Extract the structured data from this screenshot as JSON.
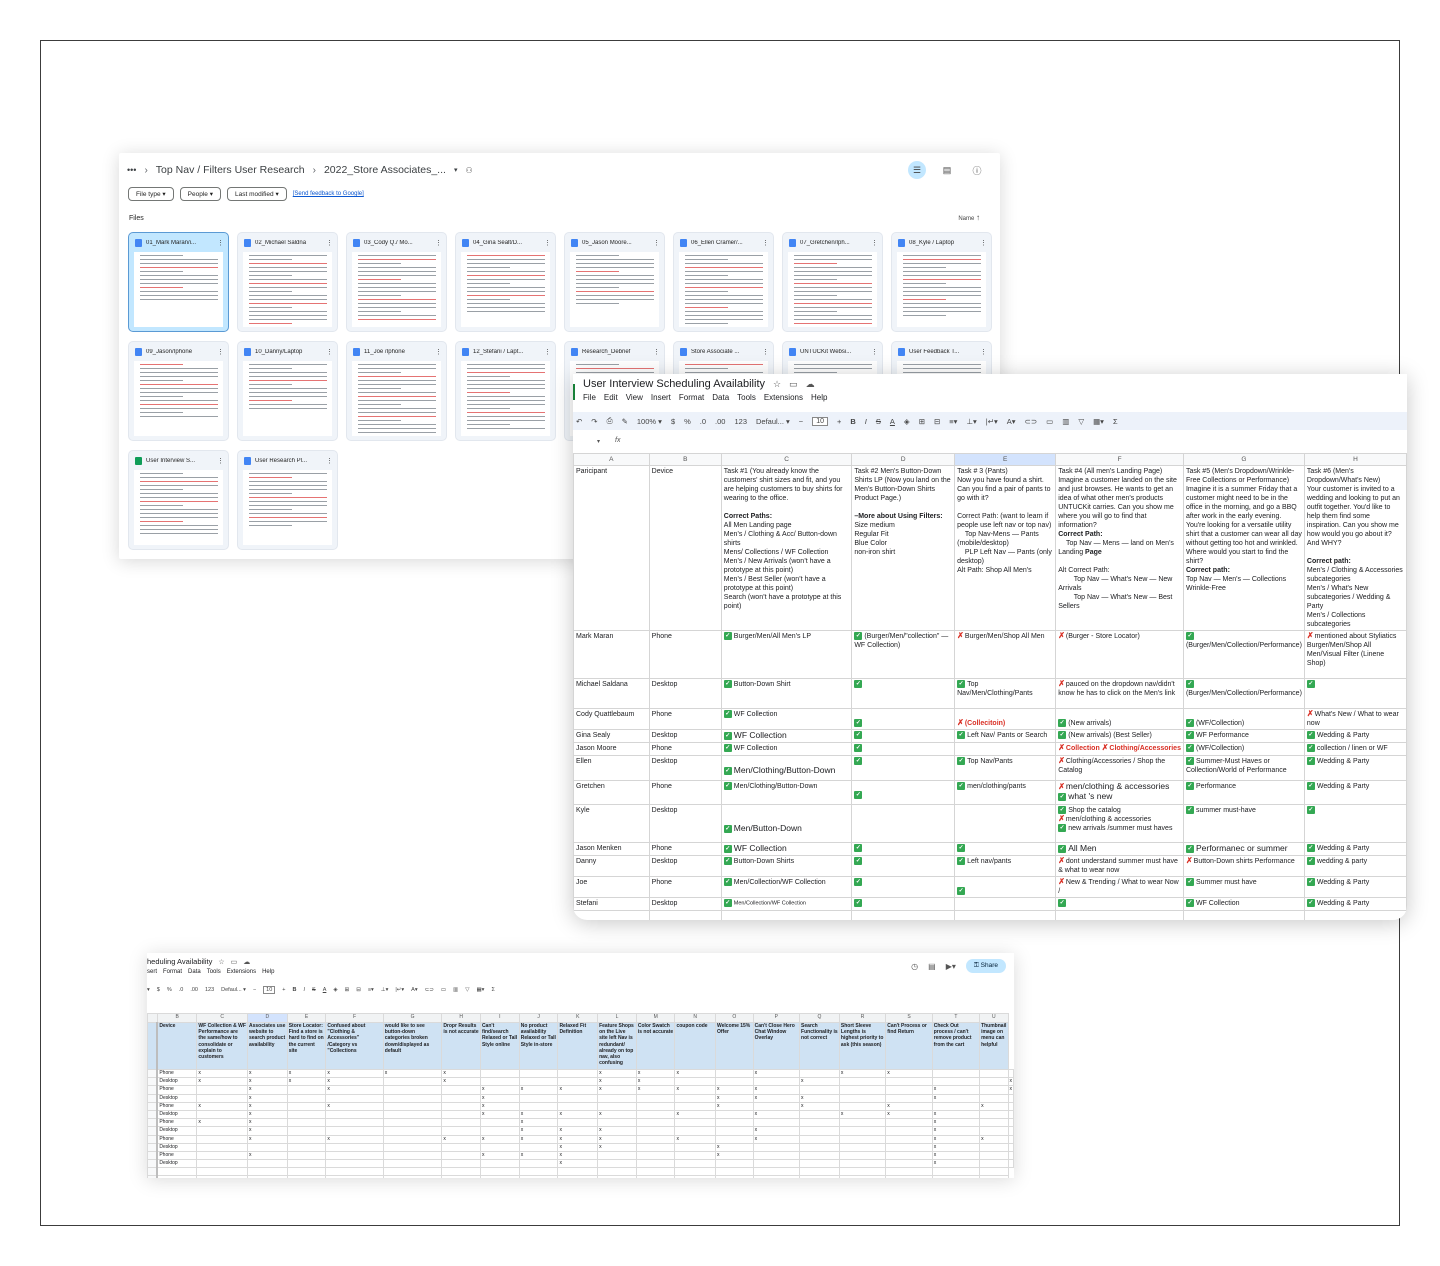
{
  "drive": {
    "breadcrumb": [
      "Top Nav / Filters User Research",
      "2022_Store Associates_..."
    ],
    "filters": [
      "File type",
      "People",
      "Last modified"
    ],
    "feedback_link": "[Send feedback to Google]",
    "files_label": "Files",
    "sort_label": "Name",
    "files": [
      {
        "name": "01_Mark Maran/i...",
        "type": "doc"
      },
      {
        "name": "02_Michael Saldna",
        "type": "doc"
      },
      {
        "name": "03_Cody Q./ Mo...",
        "type": "doc"
      },
      {
        "name": "04_Gina Sealt/D...",
        "type": "doc"
      },
      {
        "name": "05_Jason Moore...",
        "type": "doc"
      },
      {
        "name": "06_Ellen Cramer/...",
        "type": "doc"
      },
      {
        "name": "07_Gretchen/Iph...",
        "type": "doc"
      },
      {
        "name": "08_Kyle / Laptop",
        "type": "doc"
      },
      {
        "name": "09_Jason/Iphone",
        "type": "doc"
      },
      {
        "name": "10_Danny/Laptop",
        "type": "doc"
      },
      {
        "name": "11_Joe /Iphone",
        "type": "doc"
      },
      {
        "name": "12_Stefani / Lapt...",
        "type": "doc"
      },
      {
        "name": "Research_Debrief",
        "type": "doc"
      },
      {
        "name": "Store Associate ...",
        "type": "doc"
      },
      {
        "name": "UNTUCKit Websi...",
        "type": "slides"
      },
      {
        "name": "User Feedback T...",
        "type": "doc"
      },
      {
        "name": "User Interview S...",
        "type": "sheet"
      },
      {
        "name": "User Research Pl...",
        "type": "doc"
      }
    ]
  },
  "sheet": {
    "title": "User Interview Scheduling Availability",
    "menu": [
      "File",
      "Edit",
      "View",
      "Insert",
      "Format",
      "Data",
      "Tools",
      "Extensions",
      "Help"
    ],
    "zoom": "100%",
    "font": "Defaul...",
    "font_size": "10",
    "fx": "fx",
    "columns": [
      "A",
      "B",
      "C",
      "D",
      "E",
      "F",
      "G",
      "H"
    ],
    "header": {
      "a": "Paricipant",
      "b": "Device",
      "c1": "Task #1 (You already know the customers' shirt sizes and fit, and you are helping customers to buy shirts for wearing to the office.",
      "c2": "Correct Paths:",
      "c3": "All Men Landing page\nMen’s / Clothing & Acc/ Button-down shirts\nMens/ Collections / WF Collection\nMen’s / New Arrivals (won’t have a prototype at this point)\nMen’s / Best Seller (won’t have a prototype at this point)\nSearch (won’t have a prototype at this point)",
      "d1": "Task #2 Men's Button-Down Shirts LP (Now you land on the Men's Button-Down Shirts Product Page.)",
      "d2": "–More about Using Filters:",
      "d3": "Size medium\nRegular Fit\nBlue Color\nnon-iron shirt",
      "e1": "Task # 3 (Pants)\nNow you have found a shirt. Can you find a pair of pants to go with it?",
      "e2": "Correct Path: (want to learn if people use left nav or top nav)\n    Top Nav-Mens — Pants (mobile/desktop)\n    PLP Left Nav — Pants (only desktop)\nAlt Path: Shop All Men's",
      "f1": "Task #4 (All men's Landing Page) Imagine a customer landed on the site and just browses. He wants to get an idea of what other men's products UNTUCKit carries. Can you show me where you will go to find that information?",
      "f2": "Correct Path:",
      "f3": "    Top Nav — Mens — land on Men's Landing ",
      "f3b": "Page",
      "f4": "Alt Correct Path:\n        Top Nav — What's New — New Arrivals\n        Top Nav — What's New — Best Sellers",
      "g1": "Task #5 (Men's Dropdown/Wrinkle-Free Collections or Performance) Imagine it is a summer Friday that a customer might need to be in the office in the morning, and go a BBQ after work in the early evening. You're looking for a versatile utility shirt that a customer can wear all day without getting too hot and wrinkled. Where would you start to find the shirt?",
      "g2": "Correct path:",
      "g3": "Top Nav — Men's — Collections\nWrinkle-Free",
      "h1": "Task #6 (Men's Dropdown/What's New)\nYour customer is invited to a wedding and looking to put an outfit together. You'd like to help them find some inspiration. Can you show me how would you go about it? And WHY?",
      "h2": "Correct path:",
      "h3": "Men's / Clothing & Accessories subcategories\nMen's / What's New subcategories / Wedding & Party\nMen's / Collections subcategories"
    },
    "rows": [
      {
        "name": "Mark Maran",
        "device": "Phone",
        "c": "Burger/Men/All Men's LP",
        "d": "(Burger/Men/\"collection\" —WF Collection)",
        "e": "Burger/Men/Shop All Men",
        "f": "(Burger - Store Locator)",
        "g": "(Burger/Men/Collection/Performance)",
        "h": "mentioned about Styliatics Burger/Men/Shop All Men/Visual Filter (Linene Shop)"
      },
      {
        "name": "Michael Saldana",
        "device": "Desktop",
        "c": "Button-Down Shirt",
        "d": "",
        "e": "Top Nav/Men/Clothing/Pants",
        "f": "pauced on the dropdown nav/didn't know he has to click on the Men's link",
        "g": "(Burger/Men/Collection/Performance)",
        "h": ""
      },
      {
        "name": "Cody Quattlebaum",
        "device": "Phone",
        "c": "WF Collection",
        "d": "",
        "e": "(Collecitoin)",
        "f": "(New arrivals)",
        "g": "(WF/Collection)",
        "h": "What's New / What to wear now"
      },
      {
        "name": "Gina Sealy",
        "device": "Desktop",
        "c": "WF Collection",
        "d": "",
        "e": "Left Nav/ Pants or Search",
        "f": "(New arrivals) (Best Seller)",
        "g": "WF Performance",
        "h": "Wedding & Party"
      },
      {
        "name": "Jason Moore",
        "device": "Phone",
        "c": "WF Collection",
        "d": "",
        "e": "",
        "f1": "Collection",
        "f2": "Clothing/Accessories",
        "g": "(WF/Collection)",
        "h": "collection / linen or WF"
      },
      {
        "name": "Ellen",
        "device": "Desktop",
        "c": "Men/Clothing/Button-Down",
        "d": "",
        "e": "Top Nav/Pants",
        "f": "Clothing/Accessories / Shop the Catalog",
        "g": "Summer-Must Haves or Collection/World of Performance",
        "h": "Wedding & Party"
      },
      {
        "name": "Gretchen",
        "device": "Phone",
        "c": "Men/Clothing/Button-Down",
        "d": "",
        "e": "men/clothing/pants",
        "f1": "men/clothing & accessories",
        "f2": "what 's new",
        "g": "Performance",
        "h": "Wedding & Party"
      },
      {
        "name": "Kyle",
        "device": "Desktop",
        "c": "Men/Button-Down",
        "d": "",
        "e": "",
        "f1": "Shop the catalog",
        "f2": "men/clothing & accessories",
        "f3": "new arrivals /summer must haves",
        "g": "summer must-have",
        "h": ""
      },
      {
        "name": "Jason Menken",
        "device": "Phone",
        "c": "WF Collection",
        "d": "",
        "e": "",
        "f": "All Men",
        "g": "Performanec or summer",
        "h": "Wedding & Party"
      },
      {
        "name": "Danny",
        "device": "Desktop",
        "c": "Button-Down Shirts",
        "d": "",
        "e": "Left nav/pants",
        "f": "dont understand summer must have & what to wear now",
        "g": "Button-Down shirts Performance",
        "h": "wedding & party"
      },
      {
        "name": "Joe",
        "device": "Phone",
        "c": "Men/Collection/WF Collection",
        "d": "",
        "e": "",
        "f": "New & Trending  / What to wear Now /",
        "g": "Summer must have",
        "h": "Wedding & Party"
      },
      {
        "name": "Stefani",
        "device": "Desktop",
        "c": "Men/Collection/WF Collection",
        "d": "",
        "e": "",
        "f": "",
        "g": "WF Collection",
        "h": "Wedding & Party"
      }
    ]
  },
  "sheet2": {
    "title": "heduling Availability",
    "menu": [
      "sert",
      "Format",
      "Data",
      "Tools",
      "Extensions",
      "Help"
    ],
    "share": "Share",
    "font": "Defaul...",
    "font_size": "10",
    "columns": [
      "B",
      "C",
      "D",
      "E",
      "F",
      "G",
      "H",
      "I",
      "J",
      "K",
      "L",
      "M",
      "N",
      "O",
      "P",
      "Q",
      "R",
      "S",
      "T",
      "U"
    ],
    "headers": [
      "Device",
      "WF Collection & WF Performance are the same/how to consolidate or explain to customers",
      "Associates use website to search product availability",
      "Store Locator: Find a store is hard to find on the current site",
      "Confused about \"Clothing & Accessories\" /Category vs \"Collections",
      "would like to see button-down categories broken down/displayed as default",
      "Dropr Results is not accurate",
      "Can't find/search Relaxed or Tall Style online",
      "No product availability Relaxed or Tall Style in-store",
      "Relaxed Fit Definition",
      "Feature Shops on the Live site left Nav is redundant/ already on top nav, also confusing",
      "Color Swatch is not accurate",
      "coupon code",
      "Welcome 15% Offer",
      "Can't Close Hero Chat Window Overlay",
      "Search Functionality is not correct",
      "Short Sleeve Lengths is highest priority to ask (this season)",
      "Can't Process or find Return",
      "Check Out process / can't remove product from the cart",
      "Thumbnail image on menu can helpful"
    ],
    "rows": [
      [
        "Phone",
        "x",
        "x",
        "x",
        "x",
        "x",
        "x",
        "",
        "",
        "",
        "x",
        "x",
        "x",
        "",
        "x",
        "",
        "x",
        "x",
        "",
        "",
        ""
      ],
      [
        "Desktop",
        "x",
        "x",
        "x",
        "x",
        "",
        "x",
        "",
        "",
        "",
        "x",
        "x",
        "",
        "",
        "",
        "x",
        "",
        "",
        "",
        "",
        "x"
      ],
      [
        "Phone",
        "",
        "x",
        "",
        "x",
        "",
        "",
        "x",
        "x",
        "x",
        "x",
        "x",
        "x",
        "x",
        "x",
        "",
        "",
        "",
        "x",
        "",
        "x"
      ],
      [
        "Desktop",
        "",
        "x",
        "",
        "",
        "",
        "",
        "x",
        "",
        "",
        "",
        "",
        "",
        "x",
        "x",
        "x",
        "",
        "",
        "x",
        "",
        ""
      ],
      [
        "Phone",
        "x",
        "x",
        "",
        "x",
        "",
        "",
        "x",
        "",
        "",
        "",
        "",
        "",
        "x",
        "",
        "x",
        "",
        "x",
        "",
        "x",
        ""
      ],
      [
        "Desktop",
        "",
        "x",
        "",
        "",
        "",
        "",
        "x",
        "x",
        "x",
        "x",
        "",
        "x",
        "",
        "x",
        "",
        "x",
        "x",
        "x",
        "",
        ""
      ],
      [
        "Phone",
        "x",
        "x",
        "",
        "",
        "",
        "",
        "",
        "x",
        "",
        "",
        "",
        "",
        "",
        "",
        "",
        "",
        "",
        "x",
        "",
        ""
      ],
      [
        "Desktop",
        "",
        "x",
        "",
        "",
        "",
        "",
        "",
        "x",
        "x",
        "x",
        "",
        "",
        "",
        "x",
        "",
        "",
        "",
        "x",
        "",
        ""
      ],
      [
        "Phone",
        "",
        "x",
        "",
        "x",
        "",
        "x",
        "x",
        "x",
        "x",
        "x",
        "",
        "x",
        "",
        "x",
        "",
        "",
        "",
        "x",
        "x",
        ""
      ],
      [
        "Desktop",
        "",
        "",
        "",
        "",
        "",
        "",
        "",
        "",
        "x",
        "x",
        "",
        "",
        "x",
        "",
        "",
        "",
        "",
        "x",
        "",
        ""
      ],
      [
        "Phone",
        "",
        "x",
        "",
        "",
        "",
        "",
        "x",
        "x",
        "x",
        "",
        "",
        "",
        "x",
        "",
        "",
        "",
        "",
        "x",
        "",
        ""
      ],
      [
        "Desktop",
        "",
        "",
        "",
        "",
        "",
        "",
        "",
        "",
        "x",
        "",
        "",
        "",
        "",
        "",
        "",
        "",
        "",
        "x",
        "",
        ""
      ]
    ]
  }
}
